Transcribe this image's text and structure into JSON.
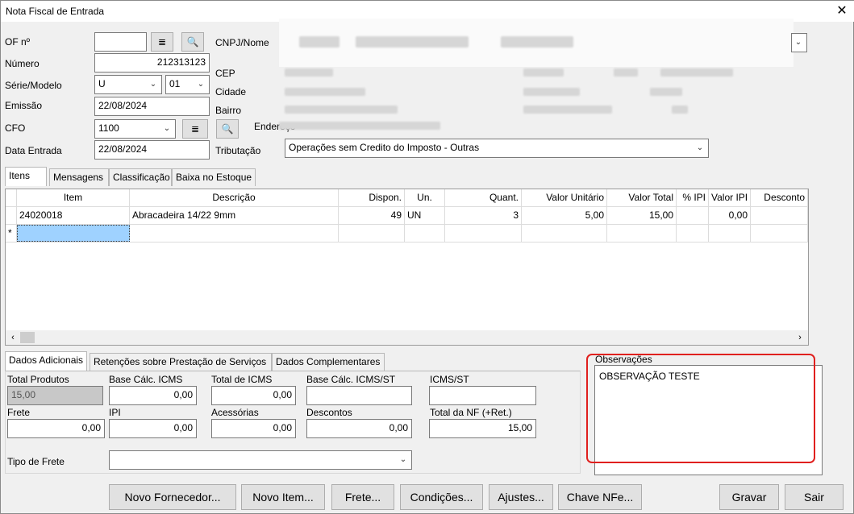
{
  "window": {
    "title": "Nota Fiscal de Entrada"
  },
  "form": {
    "of_label": "OF nº",
    "of_value": "",
    "numero_label": "Número",
    "numero_value": "212313123",
    "serie_label": "Série/Modelo",
    "serie_value": "U",
    "modelo_value": "01",
    "emissao_label": "Emissão",
    "emissao_value": "22/08/2024",
    "cfo_label": "CFO",
    "cfo_value": "1100",
    "data_entrada_label": "Data Entrada",
    "data_entrada_value": "22/08/2024",
    "cnpj_label": "CNPJ/Nome",
    "cep_label": "CEP",
    "cidade_label": "Cidade",
    "bairro_label": "Bairro",
    "endereco_label": "Endereço",
    "tributacao_label": "Tributação",
    "tributacao_value": "Operações sem Credito do Imposto - Outras"
  },
  "top_tabs": [
    "Itens",
    "Mensagens",
    "Classificação",
    "Baixa no Estoque"
  ],
  "grid": {
    "columns": [
      "Item",
      "Descrição",
      "Dispon.",
      "Un.",
      "Quant.",
      "Valor Unitário",
      "Valor Total",
      "% IPI",
      "Valor IPI",
      "Desconto"
    ],
    "rows": [
      {
        "marker": "",
        "item": "24020018",
        "descricao": "Abracadeira 14/22 9mm",
        "dispon": "49",
        "un": "UN",
        "quant": "3",
        "valor_unitario": "5,00",
        "valor_total": "15,00",
        "pct_ipi": "",
        "valor_ipi": "0,00",
        "desconto": ""
      }
    ],
    "new_row_marker": "*"
  },
  "bottom_tabs": [
    "Dados Adicionais",
    "Retenções sobre Prestação de Serviços",
    "Dados Complementares"
  ],
  "totals": {
    "total_produtos_label": "Total Produtos",
    "total_produtos_value": "15,00",
    "base_icms_label": "Base Cálc. ICMS",
    "base_icms_value": "0,00",
    "total_icms_label": "Total de ICMS",
    "total_icms_value": "0,00",
    "base_icms_st_label": "Base Cálc. ICMS/ST",
    "base_icms_st_value": "",
    "icms_st_label": "ICMS/ST",
    "icms_st_value": "",
    "frete_label": "Frete",
    "frete_value": "0,00",
    "ipi_label": "IPI",
    "ipi_value": "0,00",
    "acessorias_label": "Acessórias",
    "acessorias_value": "0,00",
    "descontos_label": "Descontos",
    "descontos_value": "0,00",
    "total_nf_label": "Total da NF (+Ret.)",
    "total_nf_value": "15,00",
    "tipo_frete_label": "Tipo de Frete",
    "tipo_frete_value": ""
  },
  "observacoes": {
    "label": "Observações",
    "value": "OBSERVAÇÃO TESTE",
    "highlight_color": "#e0201e"
  },
  "buttons": {
    "novo_fornecedor": "Novo Fornecedor...",
    "novo_item": "Novo Item...",
    "frete": "Frete...",
    "condicoes": "Condições...",
    "ajustes": "Ajustes...",
    "chave_nfe": "Chave NFe...",
    "gravar": "Gravar",
    "sair": "Sair"
  },
  "icons": {
    "close": "×",
    "list": "≣",
    "search": "⊕",
    "chevron": "⌄"
  }
}
